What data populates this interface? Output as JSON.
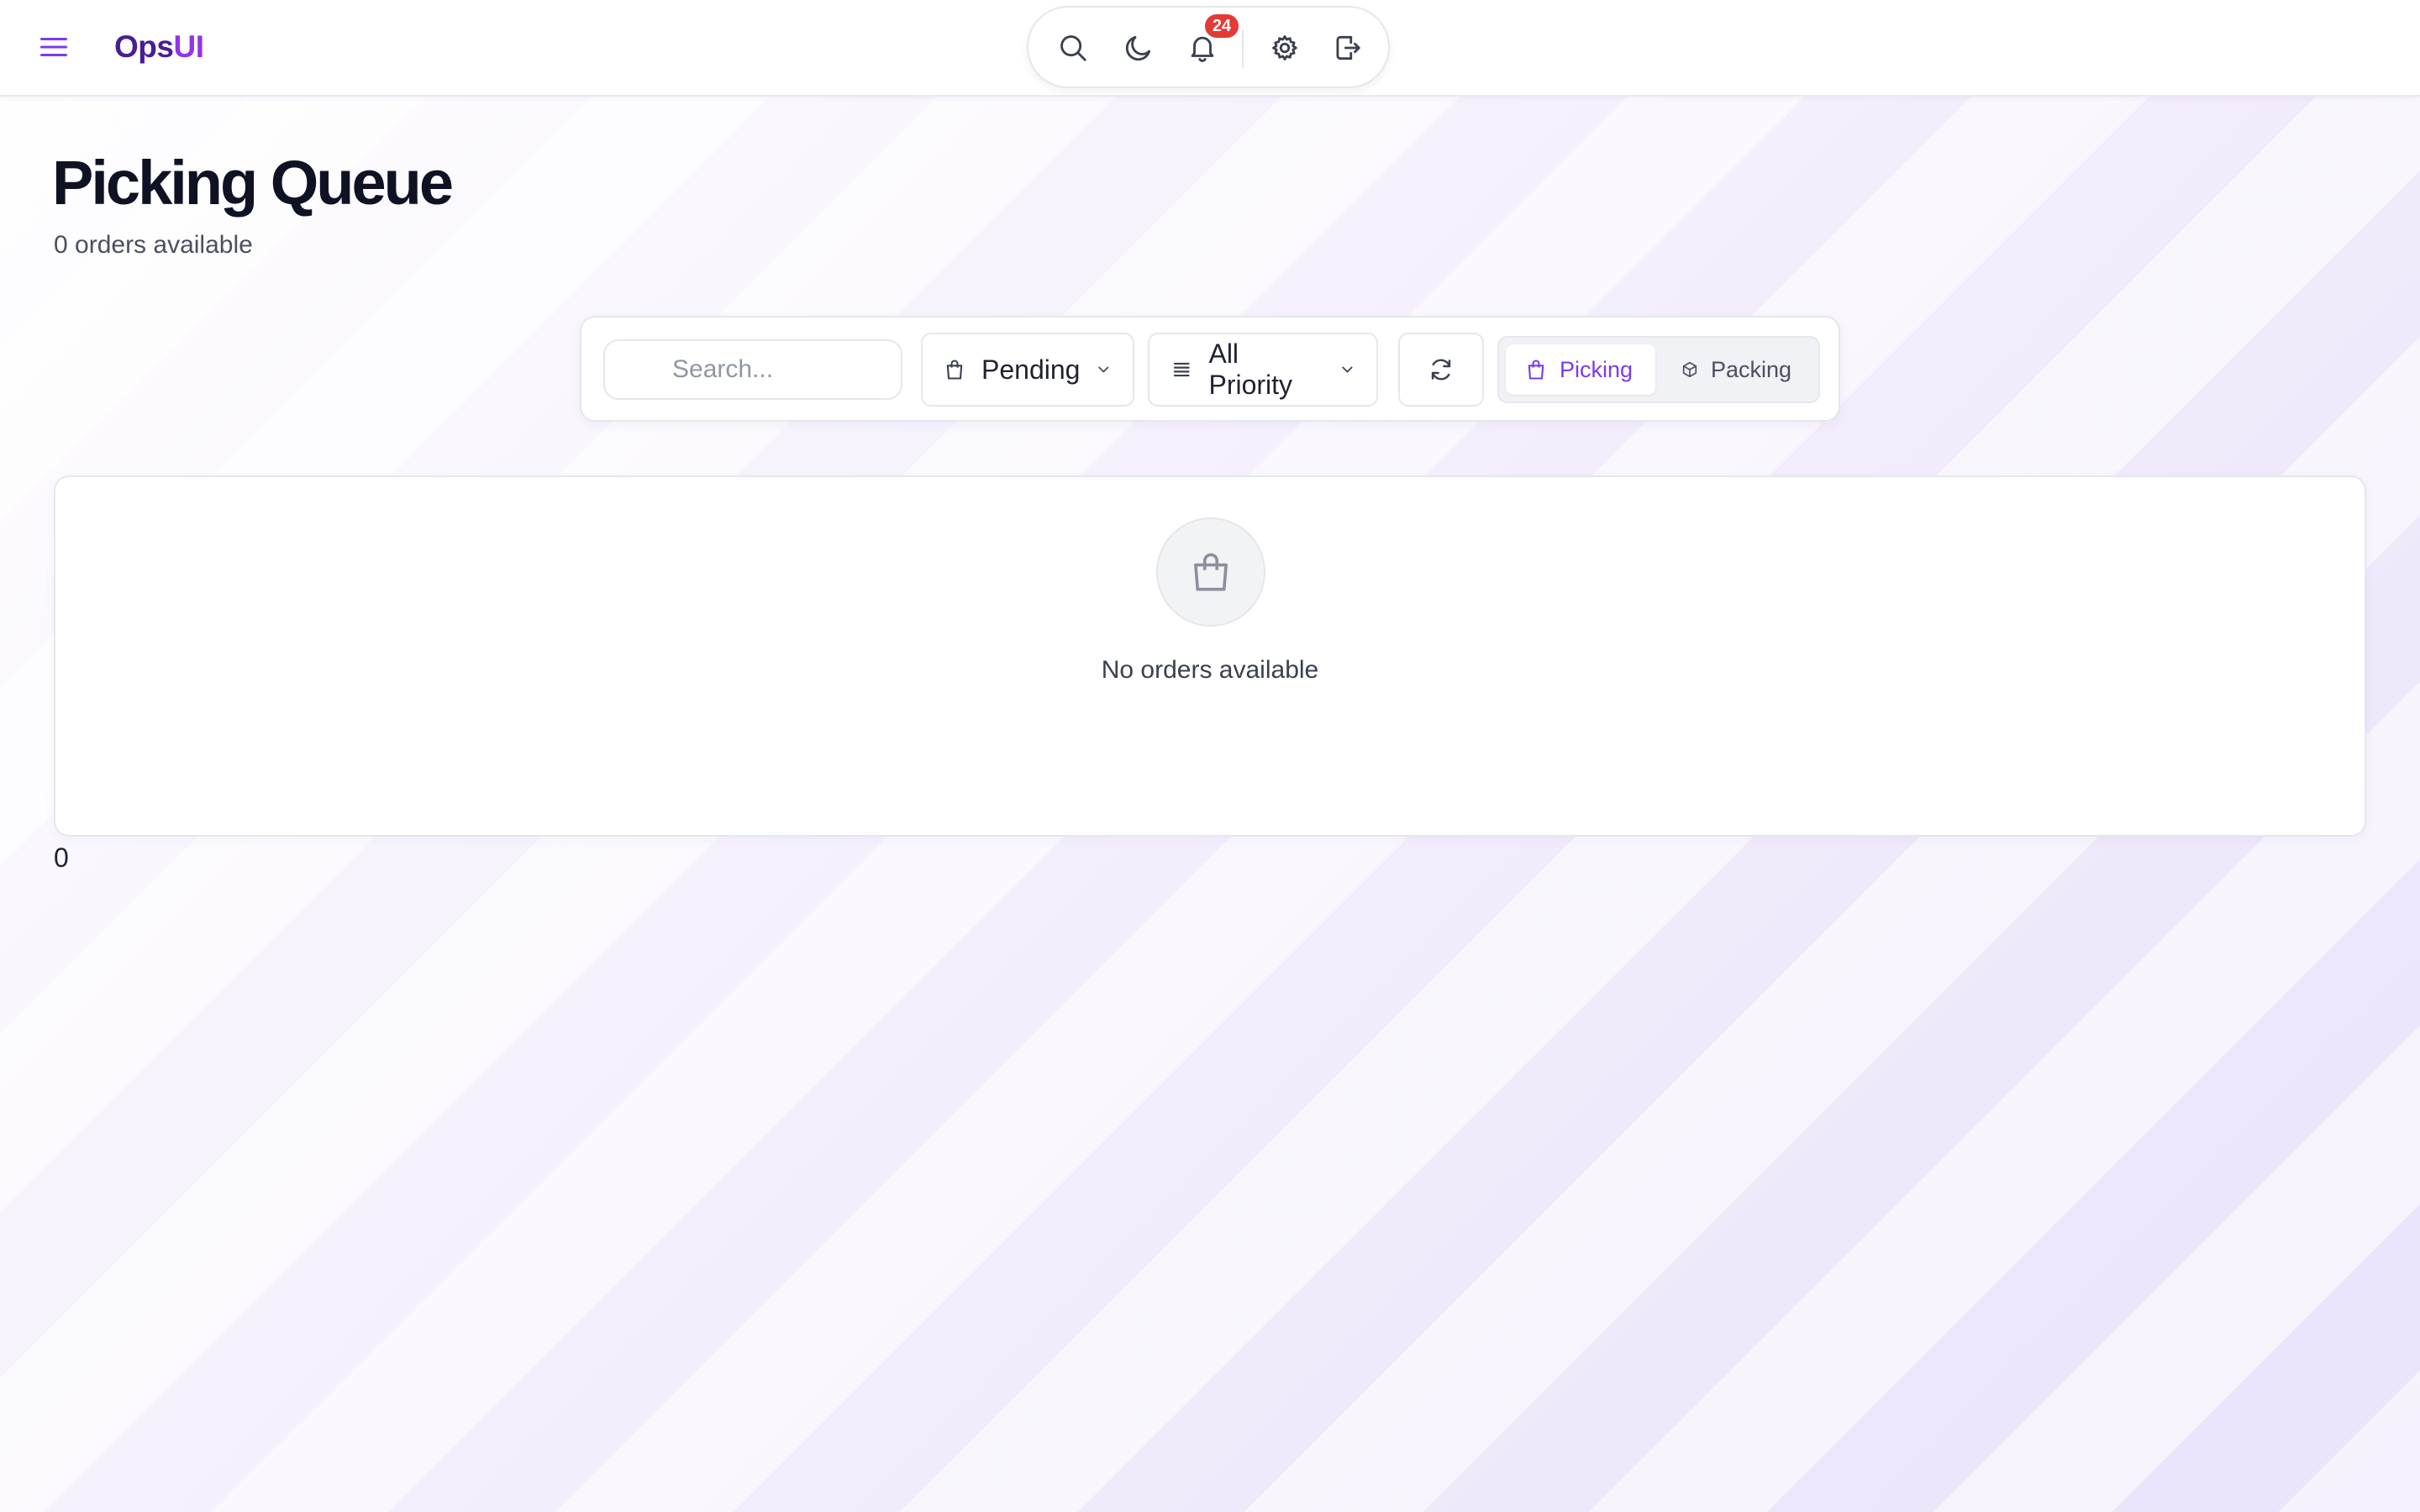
{
  "app": {
    "logo_part1": "Ops",
    "logo_part2": "UI",
    "menu_icon": "hamburger-icon"
  },
  "toolbar": {
    "icons": [
      "search-icon",
      "moon-icon",
      "bell-icon",
      "gear-icon",
      "logout-icon"
    ],
    "notification_count": "24"
  },
  "page": {
    "title": "Picking Queue",
    "subtitle": "0 orders available"
  },
  "filters": {
    "search_placeholder": "Search...",
    "search_value": "",
    "status_selected": "Pending",
    "priority_selected": "All Priority",
    "view_options": [
      {
        "label": "Picking",
        "icon": "shopping-bag-icon",
        "active": true
      },
      {
        "label": "Packing",
        "icon": "package-icon",
        "active": false
      }
    ]
  },
  "empty_state": {
    "icon": "shopping-bag-icon",
    "message": "No orders available"
  },
  "footer": {
    "count": "0"
  },
  "colors": {
    "accent": "#7c3aed",
    "logo_dark": "#4a1d96",
    "logo_light": "#9333ea",
    "badge": "#e53935"
  }
}
